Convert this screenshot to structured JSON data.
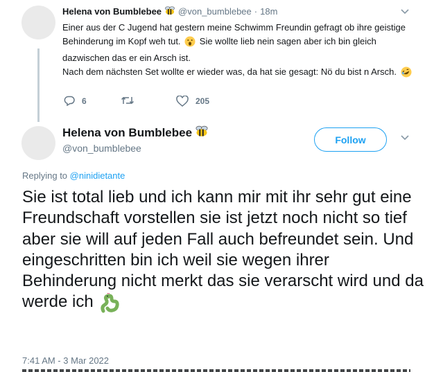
{
  "tweet1": {
    "display_name": "Helena von Bumblebee",
    "handle": "@von_bumblebee",
    "separator": "·",
    "time": "18m",
    "text_part1": "Einer aus der C Jugend hat gestern meine Schwimm Freundin gefragt ob ihre geistige Behinderung im Kopf weh tut. ",
    "text_part2": " Sie wollte lieb nein sagen aber ich bin gleich dazwischen das er ein Arsch ist.",
    "text_line2": "Nach dem nächsten Set wollte er wieder was, da hat sie gesagt: Nö du bist n Arsch. ",
    "emoji1": "surprised-face-emoji",
    "emoji2": "rolling-laughing-emoji",
    "reply_count": "6",
    "retweet_count": "",
    "like_count": "205"
  },
  "tweet2": {
    "display_name": "Helena von Bumblebee",
    "handle": "@von_bumblebee",
    "follow_label": "Follow",
    "replying_prefix": "Replying to ",
    "replying_to": "@ninidietante",
    "text": "Sie ist total lieb und ich kann mir mit ihr sehr gut eine Freundschaft vorstellen sie ist jetzt noch nicht so tief aber sie will auf jeden Fall auch befreundet sein. Und eingeschritten bin ich weil sie wegen ihrer Behinderung nicht merkt das sie verarscht wird und da werde ich ",
    "emoji": "worm-emoji",
    "timestamp": "7:41 AM - 3 Mar 2022"
  },
  "colors": {
    "accent": "#1da1f2",
    "secondary_text": "#657786",
    "thread_line": "#c4cfd6",
    "primary_text": "#14171a"
  }
}
